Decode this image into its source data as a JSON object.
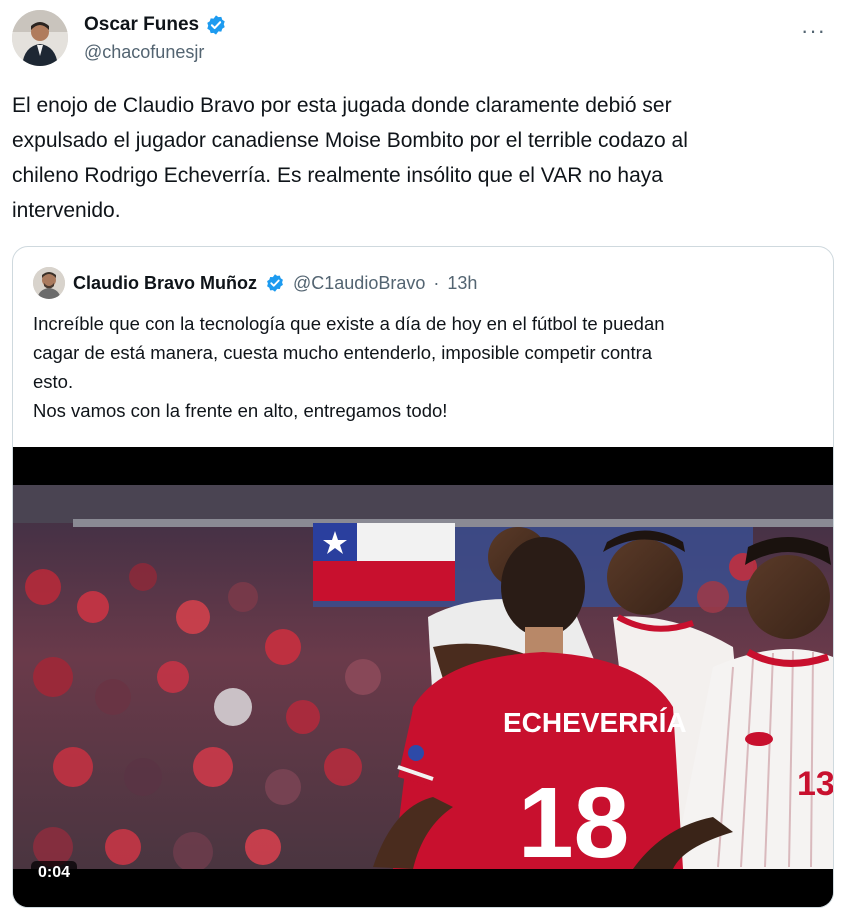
{
  "author": {
    "name": "Oscar Funes",
    "handle": "@chacofunesjr",
    "verified": true
  },
  "more_icon": "more-horizontal-icon",
  "tweet": {
    "text": "El enojo de Claudio Bravo por esta jugada donde claramente debió ser\nexpulsado el jugador canadiense Moise Bombito por el terrible codazo al\nchileno Rodrigo Echeverría. Es realmente insólito que el VAR no haya\nintervenido."
  },
  "quoted_tweet": {
    "author_name": "Claudio Bravo Muñoz",
    "handle": "@C1audioBravo",
    "separator": "·",
    "time": "13h",
    "verified": true,
    "text": "Increíble que con la tecnología que existe a día de hoy en el fútbol te puedan\ncagar de está manera, cuesta mucho entenderlo, imposible competir contra\nesto.\nNos vamos con la frente en alto, entregamos todo!"
  },
  "video": {
    "timestamp": "0:04",
    "jersey_name": "ECHEVERRÍA",
    "jersey_number": "18",
    "opponent_number": "13"
  },
  "colors": {
    "verified_blue": "#1d9bf0",
    "text_primary": "#0f1419",
    "text_secondary": "#536471",
    "border": "#cfd9de",
    "chile_red": "#c8102e"
  }
}
